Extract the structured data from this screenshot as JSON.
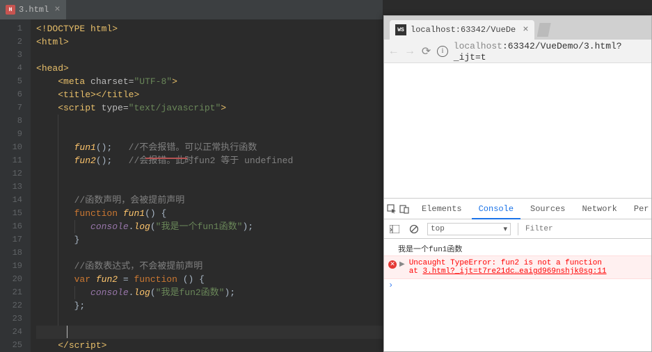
{
  "editor": {
    "tab": {
      "filename": "3.html",
      "icon_text": "H"
    },
    "lines": [
      "1",
      "2",
      "3",
      "4",
      "5",
      "6",
      "7",
      "8",
      "9",
      "10",
      "11",
      "12",
      "13",
      "14",
      "15",
      "16",
      "17",
      "18",
      "19",
      "20",
      "21",
      "22",
      "23",
      "24",
      "25"
    ],
    "code": {
      "l1_doctype": "<!DOCTYPE html>",
      "l2a": "<",
      "l2b": "html",
      "l2c": ">",
      "l4a": "<",
      "l4b": "head",
      "l4c": ">",
      "l5a": "<",
      "l5b": "meta ",
      "l5attr": "charset=",
      "l5str": "\"UTF-8\"",
      "l5c": ">",
      "l6a": "<",
      "l6b": "title",
      "l6c": "></",
      "l6d": "title",
      "l6e": ">",
      "l7a": "<",
      "l7b": "script ",
      "l7attr": "type=",
      "l7str": "\"text/javascript\"",
      "l7c": ">",
      "l10_fn": "fun1",
      "l10_rest": "();",
      "l10_cmt": "   //不会报错。可以正常执行函数",
      "l11_fn": "fun2",
      "l11_rest": "();",
      "l11_cmt": "   //会报错。此时fun2 等于 undefined",
      "l14_cmt": "//函数声明，会被提前声明",
      "l15_kw": "function ",
      "l15_fn": "fun1",
      "l15_rest": "() {",
      "l16_obj": "console",
      "l16_dot": ".",
      "l16_log": "log",
      "l16_p1": "(",
      "l16_str": "\"我是一个fun1函数\"",
      "l16_p2": ");",
      "l17": "}",
      "l19_cmt": "//函数表达式，不会被提前声明",
      "l20_kw": "var ",
      "l20_fn": "fun2 ",
      "l20_eq": "= ",
      "l20_kw2": "function ",
      "l20_rest": "() {",
      "l21_obj": "console",
      "l21_dot": ".",
      "l21_log": "log",
      "l21_p1": "(",
      "l21_str": "\"我是fun2函数\"",
      "l21_p2": ");",
      "l22": "};",
      "l25a": "</",
      "l25b": "script",
      "l25c": ">"
    }
  },
  "browser": {
    "tab_icon": "WS",
    "tab_title": "localhost:63342/VueDe",
    "url_gray1": "localhost",
    "url_port": ":63342/VueDemo/3.html?_ijt=t",
    "devtools": {
      "tabs": {
        "elements": "Elements",
        "console": "Console",
        "sources": "Sources",
        "network": "Network",
        "perf": "Per"
      },
      "context": "top",
      "filter_placeholder": "Filter",
      "log1": "我是一个fun1函数",
      "err1": "Uncaught TypeError: fun2 is not a function",
      "err2_pre": "    at ",
      "err2_link": "3.html?_ijt=t7re21dc…eaigd969nshjk0sg:11"
    }
  }
}
